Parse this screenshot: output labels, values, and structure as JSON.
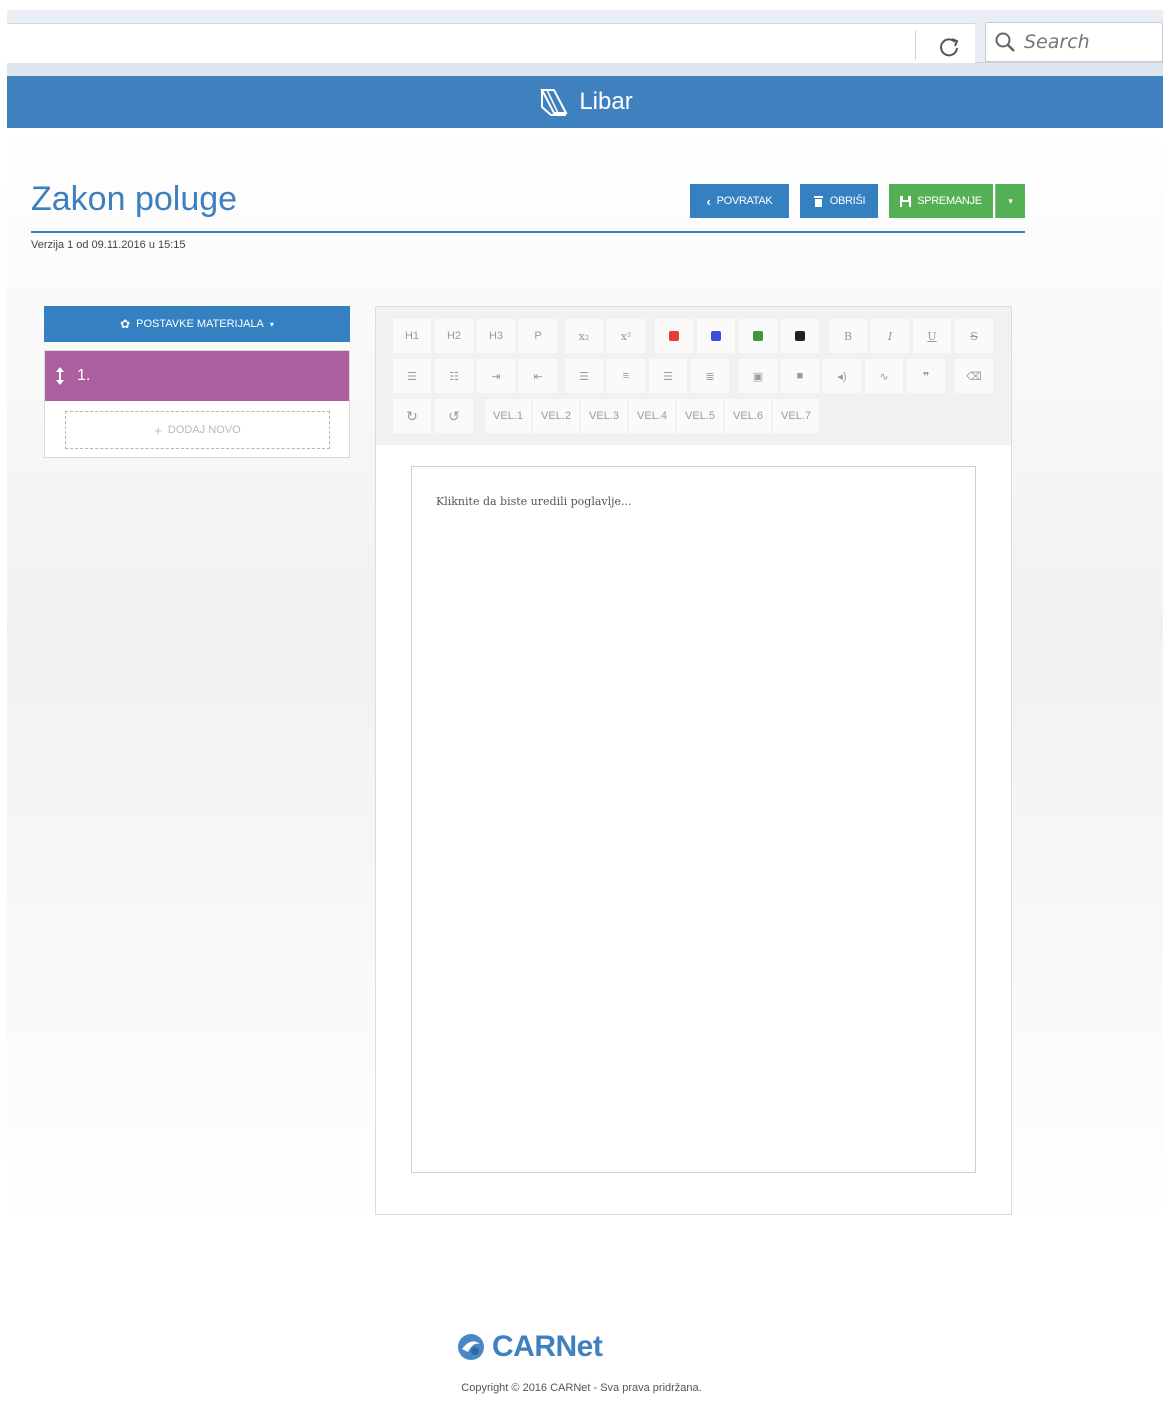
{
  "browser": {
    "reload_icon": "reload-icon",
    "search_placeholder": "Search"
  },
  "app": {
    "brand": "Libar",
    "brand_icon": "book-icon",
    "accent_color": "#3f80bf"
  },
  "document": {
    "title": "Zakon poluge",
    "version": "Verzija 1 od 09.11.2016 u 15:15"
  },
  "actions": {
    "back_label": "POVRATAK",
    "delete_label": "OBRIŠI",
    "save_label": "SPREMANJE",
    "save_color": "#55b055"
  },
  "sidebar": {
    "settings_label": "POSTAVKE MATERIJALA",
    "chapters": [
      {
        "label": "1.",
        "color": "#ac5f9f"
      }
    ],
    "add_new_label": "DODAJ NOVO"
  },
  "toolbar": {
    "row1": [
      "H1",
      "H2",
      "H3",
      "P",
      "x₂",
      "x²",
      "red",
      "blue",
      "green",
      "black",
      "B",
      "I",
      "U",
      "S"
    ],
    "row2": [
      "list-ul-icon",
      "list-ol-icon",
      "indent-icon",
      "outdent-icon",
      "align-left-icon",
      "align-center-icon",
      "align-right-icon",
      "align-justify-icon",
      "image-icon",
      "video-icon",
      "audio-icon",
      "link-icon",
      "quote-icon",
      "eraser-icon"
    ],
    "row3": [
      "redo-icon",
      "undo-icon",
      "VEL.1",
      "VEL.2",
      "VEL.3",
      "VEL.4",
      "VEL.5",
      "VEL.6",
      "VEL.7"
    ],
    "colors": {
      "red": "#e83c3c",
      "blue": "#3a4fd6",
      "green": "#3a9a3a",
      "black": "#222222"
    }
  },
  "editor": {
    "placeholder": "Kliknite da biste uredili poglavlje..."
  },
  "footer": {
    "logo": "CARNet",
    "copyright": "Copyright © 2016 CARNet - Sva prava pridržana."
  }
}
